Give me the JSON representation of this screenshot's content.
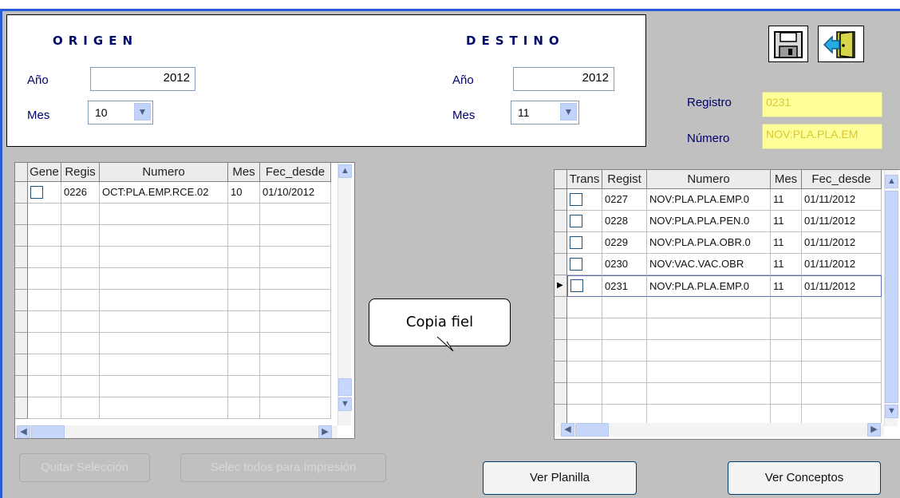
{
  "origen": {
    "heading": "ORIGEN",
    "anio_label": "Año",
    "anio_value": "2012",
    "mes_label": "Mes",
    "mes_value": "10"
  },
  "destino": {
    "heading": "DESTINO",
    "anio_label": "Año",
    "anio_value": "2012",
    "mes_label": "Mes",
    "mes_value": "11"
  },
  "toolbar": {
    "save_icon": "floppy-disk-icon",
    "exit_icon": "door-exit-icon"
  },
  "registro": {
    "label": "Registro",
    "value": "0231"
  },
  "numero": {
    "label": "Número",
    "value": "NOV:PLA.PLA.EM"
  },
  "left_grid": {
    "columns": [
      "Gene",
      "Regis",
      "Numero",
      "Mes",
      "Fec_desde"
    ],
    "rows": [
      {
        "registro": "0226",
        "numero": "OCT:PLA.EMP.RCE.02",
        "mes": "10",
        "fecha": "01/10/2012"
      }
    ]
  },
  "right_grid": {
    "columns": [
      "Trans",
      "Regist",
      "Numero",
      "Mes",
      "Fec_desde"
    ],
    "rows": [
      {
        "registro": "0227",
        "numero": "NOV:PLA.PLA.EMP.0",
        "mes": "11",
        "fecha": "01/11/2012"
      },
      {
        "registro": "0228",
        "numero": "NOV:PLA.PLA.PEN.0",
        "mes": "11",
        "fecha": "01/11/2012"
      },
      {
        "registro": "0229",
        "numero": "NOV:PLA.PLA.OBR.0",
        "mes": "11",
        "fecha": "01/11/2012"
      },
      {
        "registro": "0230",
        "numero": "NOV:VAC.VAC.OBR",
        "mes": "11",
        "fecha": "01/11/2012"
      },
      {
        "registro": "0231",
        "numero": "NOV:PLA.PLA.EMP.0",
        "mes": "11",
        "fecha": "01/11/2012"
      }
    ]
  },
  "buttons": {
    "quitar": "Quitar Selección",
    "selec_todos": "Selec todos para Impresión",
    "ver_planilla": "Ver Planilla",
    "ver_conceptos": "Ver Conceptos"
  },
  "callout": {
    "text": "Copia fiel"
  }
}
